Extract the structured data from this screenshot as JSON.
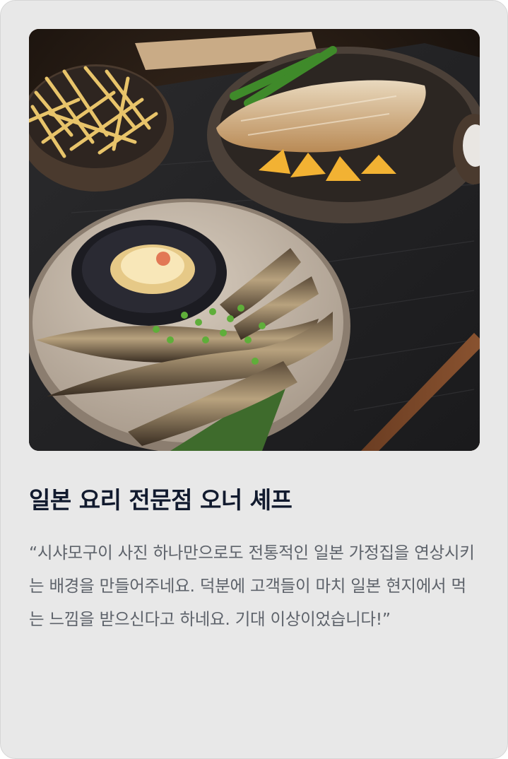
{
  "testimonial": {
    "image_alt": "grilled fish dishes on a dark wooden table",
    "title": "일본 요리 전문점 오너 셰프",
    "quote": "“시샤모구이 사진 하나만으로도 전통적인 일본 가정집을 연상시키는 배경을 만들어주네요. 덕분에 고객들이 마치 일본 현지에서 먹는 느낌을 받으신다고 하네요. 기대 이상이었습니다!”"
  },
  "colors": {
    "card_background": "#e8e8e8",
    "title": "#111a2e",
    "quote": "#5e636b"
  }
}
